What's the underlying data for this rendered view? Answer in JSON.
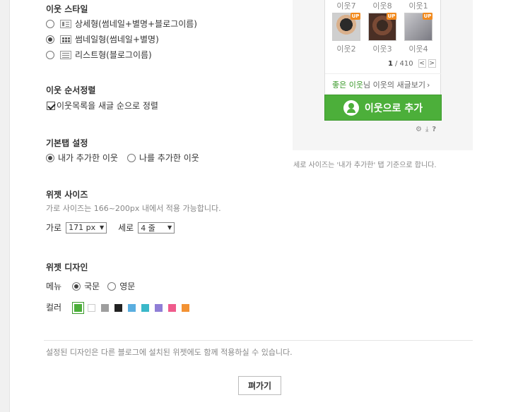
{
  "style": {
    "title": "이웃 스타일",
    "options": [
      {
        "label": "상세형(썸네일+별명+블로그이름)",
        "icon": "detail-layout-icon",
        "selected": false
      },
      {
        "label": "썸네일형(썸네일+별명)",
        "icon": "thumbnail-layout-icon",
        "selected": true
      },
      {
        "label": "리스트형(블로그이름)",
        "icon": "list-layout-icon",
        "selected": false
      }
    ]
  },
  "sort": {
    "title": "이웃 순서정렬",
    "checkbox_label": "이웃목록을 새글 순으로 정렬",
    "checked": true
  },
  "default_tab": {
    "title": "기본탭 설정",
    "options": [
      {
        "label": "내가 추가한 이웃",
        "selected": true
      },
      {
        "label": "나를 추가한 이웃",
        "selected": false
      }
    ]
  },
  "widget_size": {
    "title": "위젯 사이즈",
    "hint": "가로 사이즈는 166~200px 내에서 적용 가능합니다.",
    "width_label": "가로",
    "width_value": "171 px",
    "height_label": "세로",
    "height_value": "4 줄"
  },
  "widget_design": {
    "title": "위젯 디자인",
    "menu_label": "메뉴",
    "menu_options": [
      {
        "label": "국문",
        "selected": true
      },
      {
        "label": "영문",
        "selected": false
      }
    ],
    "color_label": "컬러",
    "colors": [
      "#4caf3a",
      "#ffffff",
      "#9e9e9e",
      "#222222",
      "#5aaee0",
      "#3ab8c9",
      "#8f7ed6",
      "#ef5b8c",
      "#f39233"
    ],
    "selected_color": 0
  },
  "footer": {
    "note": "설정된 디자인은 다른 블로그에 설치된 위젯에도 함께 적용하실 수 있습니다.",
    "apply_label": "펴가기"
  },
  "preview": {
    "top_names": [
      "이웃7",
      "이웃8",
      "이웃1"
    ],
    "neighbors": [
      {
        "name": "이웃2",
        "badge": "UP"
      },
      {
        "name": "이웃3",
        "badge": "UP"
      },
      {
        "name": "이웃4",
        "badge": "UP"
      }
    ],
    "pager_current": "1",
    "pager_total": "/ 410",
    "pager_prev": "<",
    "pager_next": ">",
    "link_highlight": "좋은 이웃",
    "link_rest": "님 이웃의 새글보기",
    "link_arrow": "›",
    "add_button": "이웃으로 추가",
    "tool_icons": [
      "gear-icon",
      "download-icon",
      "help-icon"
    ],
    "help_text": "?",
    "caption": "세로 사이즈는 '내가 추가한' 탭 기준으로 합니다."
  }
}
